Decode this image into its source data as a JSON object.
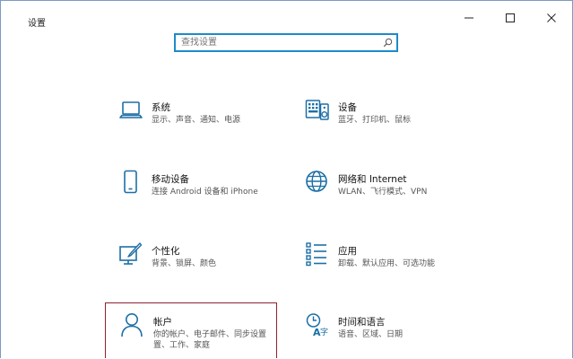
{
  "window": {
    "title": "设置",
    "accent_color": "#1d6fa5",
    "highlight_color": "#8b2330"
  },
  "search": {
    "placeholder": "查找设置",
    "icon": "search-icon"
  },
  "tiles": [
    {
      "label": "系统",
      "desc": [
        "显示、声音、通知、电源"
      ],
      "icon": "laptop-icon"
    },
    {
      "label": "设备",
      "desc": [
        "蓝牙、打印机、鼠标"
      ],
      "icon": "keyboard-speaker-icon"
    },
    {
      "label": "移动设备",
      "desc": [
        "连接 Android 设备和 iPhone"
      ],
      "icon": "phone-icon"
    },
    {
      "label": "网络和 Internet",
      "desc": [
        "WLAN、飞行模式、VPN"
      ],
      "icon": "globe-icon"
    },
    {
      "label": "个性化",
      "desc": [
        "背景、锁屏、颜色"
      ],
      "icon": "paint-icon"
    },
    {
      "label": "应用",
      "desc": [
        "卸载、默认应用、可选功能"
      ],
      "icon": "apps-list-icon"
    },
    {
      "label": "帐户",
      "desc": [
        "你的帐户、电子邮件、同步设置",
        "置、工作、家庭"
      ],
      "icon": "person-icon"
    },
    {
      "label": "时间和语言",
      "desc": [
        "语音、区域、日期"
      ],
      "icon": "time-language-icon"
    }
  ]
}
